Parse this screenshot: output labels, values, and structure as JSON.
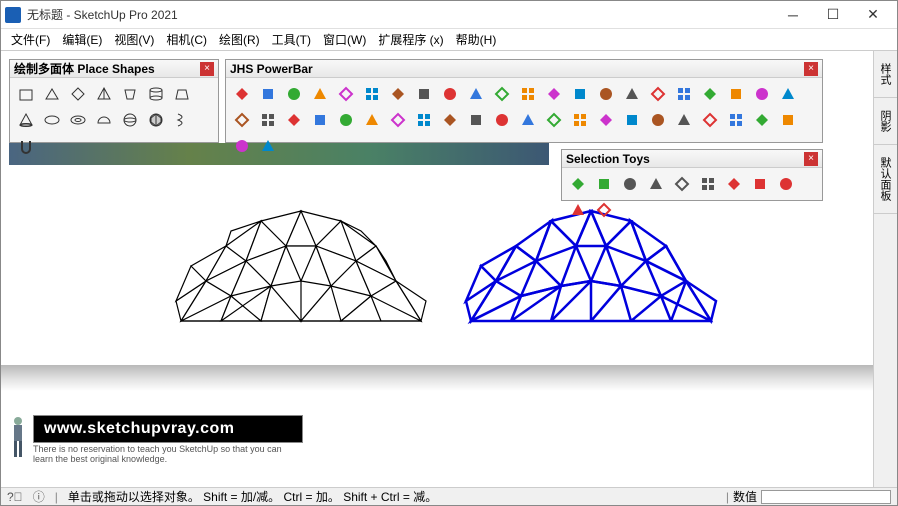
{
  "window": {
    "title": "无标题 - SketchUp Pro 2021"
  },
  "menu": {
    "file": "文件(F)",
    "edit": "编辑(E)",
    "view": "视图(V)",
    "camera": "相机(C)",
    "draw": "绘图(R)",
    "tools": "工具(T)",
    "window": "窗口(W)",
    "extensions": "扩展程序 (x)",
    "help": "帮助(H)"
  },
  "toolbars": {
    "place_shapes": {
      "title": "绘制多面体 Place Shapes"
    },
    "jhs": {
      "title": "JHS PowerBar"
    },
    "selection_toys": {
      "title": "Selection Toys"
    }
  },
  "right_tabs": {
    "styles": "样式",
    "shadows": "阴影",
    "default_panel": "默认面板"
  },
  "watermark": {
    "url": "www.sketchupvray.com",
    "tagline": "There is no reservation to teach you SketchUp so that you can learn the best original knowledge."
  },
  "statusbar": {
    "hint": "单击或拖动以选择对象。 Shift = 加/减。 Ctrl = 加。 Shift + Ctrl = 减。",
    "value_label": "数值"
  },
  "icons": {
    "place_shapes": [
      "cube",
      "prism",
      "rhombus",
      "pyramid",
      "cup",
      "cylinder",
      "frustum",
      "cone",
      "oval",
      "torus",
      "hemisphere",
      "sphere",
      "geodesic",
      "helix",
      "magnet"
    ],
    "jhs_row1": [
      "red-flag",
      "blue-diamond",
      "green-diamond",
      "orange-cube",
      "red-book",
      "sheet",
      "orange-arc",
      "purple-arc",
      "orange-rot",
      "paint",
      "panel",
      "flag",
      "pie",
      "pie2",
      "eraser",
      "target",
      "line",
      "plus-red",
      "plus-green",
      "grid",
      "dots",
      "drop",
      "drop2"
    ],
    "jhs_row2": [
      "tri-y",
      "tri-g",
      "tri-o",
      "sparkle",
      "box-r",
      "undo",
      "redo",
      "boxes1",
      "boxes2",
      "boxes3",
      "stack1",
      "stack2",
      "grid-b",
      "grid-y",
      "grid-p",
      "grid-r",
      "hex",
      "grid-o1",
      "grid-o2",
      "grid-o3",
      "path1",
      "path2",
      "path3"
    ],
    "selection_toys": [
      "diamond-g",
      "diamond-f",
      "cube-w",
      "cube-dots",
      "lines1",
      "lines2",
      "diamond-r",
      "cube-r",
      "cubes-r",
      "lines-r1",
      "lines-r2"
    ]
  }
}
